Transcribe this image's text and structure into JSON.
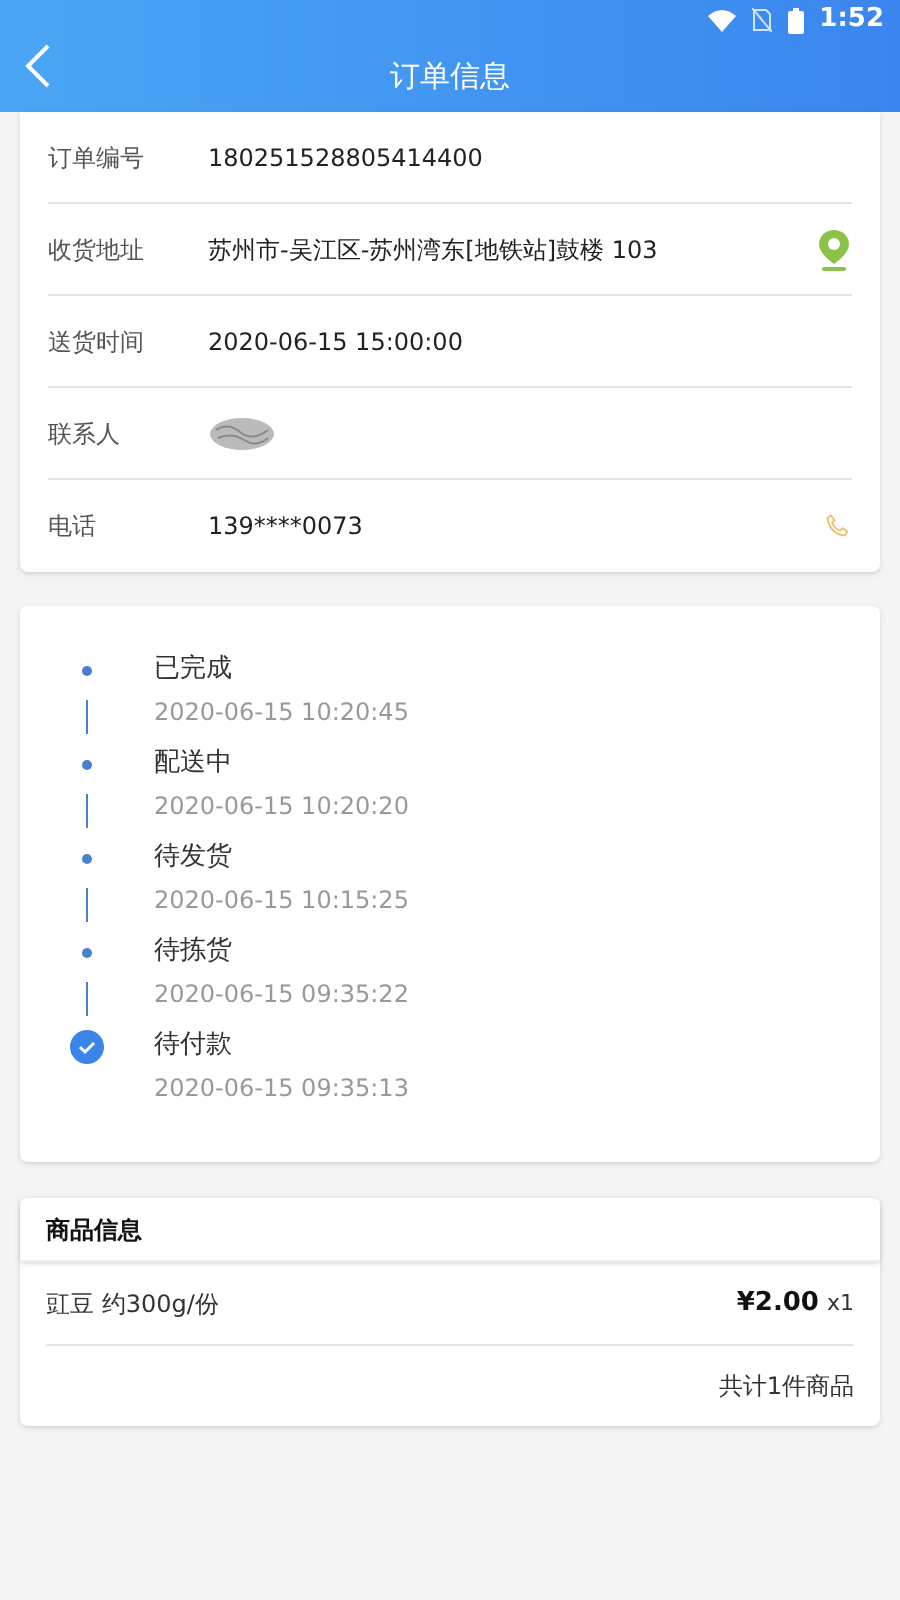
{
  "status_bar": {
    "time": "1:52"
  },
  "header": {
    "title": "订单信息"
  },
  "order_info": [
    {
      "kind": "text",
      "label": "订单编号",
      "value": "180251528805414400"
    },
    {
      "kind": "address",
      "label": "收货地址",
      "value": "苏州市-吴江区-苏州湾东[地铁站]鼓楼 103"
    },
    {
      "kind": "text",
      "label": "送货时间",
      "value": "2020-06-15 15:00:00"
    },
    {
      "kind": "redacted",
      "label": "联系人"
    },
    {
      "kind": "phone",
      "label": "电话",
      "value": "139****0073"
    }
  ],
  "timeline": [
    {
      "status": "已完成",
      "time": "2020-06-15 10:20:45",
      "current": false
    },
    {
      "status": "配送中",
      "time": "2020-06-15 10:20:20",
      "current": false
    },
    {
      "status": "待发货",
      "time": "2020-06-15 10:15:25",
      "current": false
    },
    {
      "status": "待拣货",
      "time": "2020-06-15 09:35:22",
      "current": false
    },
    {
      "status": "待付款",
      "time": "2020-06-15 09:35:13",
      "current": true
    }
  ],
  "goods": {
    "title": "商品信息",
    "items": [
      {
        "name": "豇豆 约300g/份",
        "price": "¥2.00",
        "quantity": "x1"
      }
    ],
    "total": "共计1件商品"
  }
}
